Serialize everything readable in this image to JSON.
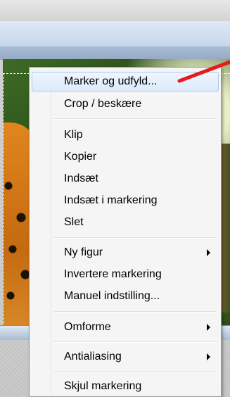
{
  "context_menu": {
    "items": [
      {
        "label": "Marker og udfyld...",
        "submenu": false,
        "highlighted": true
      },
      {
        "label": "Crop / beskære",
        "submenu": false,
        "highlighted": false
      },
      {
        "label": "Klip",
        "submenu": false,
        "highlighted": false
      },
      {
        "label": "Kopier",
        "submenu": false,
        "highlighted": false
      },
      {
        "label": "Indsæt",
        "submenu": false,
        "highlighted": false
      },
      {
        "label": "Indsæt i markering",
        "submenu": false,
        "highlighted": false
      },
      {
        "label": "Slet",
        "submenu": false,
        "highlighted": false
      },
      {
        "label": "Ny figur",
        "submenu": true,
        "highlighted": false
      },
      {
        "label": "Invertere markering",
        "submenu": false,
        "highlighted": false
      },
      {
        "label": "Manuel indstilling...",
        "submenu": false,
        "highlighted": false
      },
      {
        "label": "Omforme",
        "submenu": true,
        "highlighted": false
      },
      {
        "label": "Antialiasing",
        "submenu": true,
        "highlighted": false
      },
      {
        "label": "Skjul markering",
        "submenu": false,
        "highlighted": false
      }
    ]
  },
  "annotation": {
    "arrow_color": "#e41b1b",
    "arrow_icon": "red-pointer-arrow-icon"
  },
  "colors": {
    "highlight_border": "#a9c9ef",
    "menu_background": "#f5f5f5"
  }
}
